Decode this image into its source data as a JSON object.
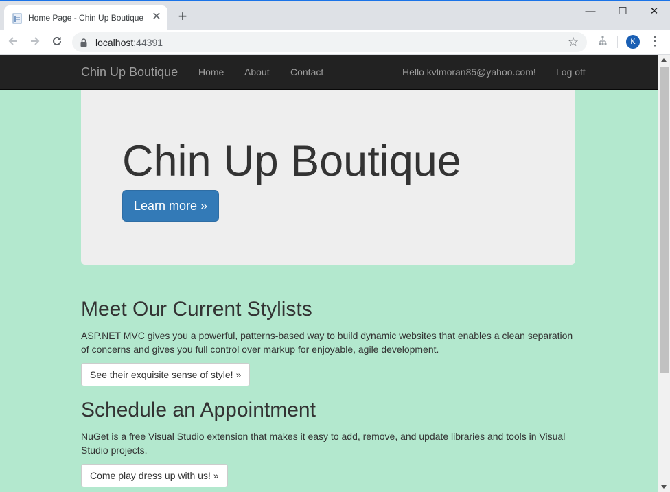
{
  "browser": {
    "tab_title": "Home Page - Chin Up Boutique",
    "new_tab_label": "+",
    "close_tab_label": "✕",
    "url_host": "localhost",
    "url_port": ":44391",
    "profile_initial": "K",
    "window_controls": {
      "minimize": "—",
      "maximize": "☐",
      "close": "✕"
    }
  },
  "navbar": {
    "brand": "Chin Up Boutique",
    "links": [
      "Home",
      "About",
      "Contact"
    ],
    "greeting": "Hello kvlmoran85@yahoo.com!",
    "logoff": "Log off"
  },
  "jumbotron": {
    "title": "Chin Up Boutique",
    "button": "Learn more »"
  },
  "sections": [
    {
      "title": "Meet Our Current Stylists",
      "text": "ASP.NET MVC gives you a powerful, patterns-based way to build dynamic websites that enables a clean separation of concerns and gives you full control over markup for enjoyable, agile development.",
      "button": "See their exquisite sense of style! »"
    },
    {
      "title": "Schedule an Appointment",
      "text": "NuGet is a free Visual Studio extension that makes it easy to add, remove, and update libraries and tools in Visual Studio projects.",
      "button": "Come play dress up with us! »"
    }
  ],
  "colors": {
    "page_background": "#b3e8ce",
    "navbar": "#222222",
    "jumbotron": "#eeeeee",
    "primary": "#337ab7"
  },
  "icons": [
    "page-favicon-icon",
    "back-arrow-icon",
    "forward-arrow-icon",
    "reload-icon",
    "lock-icon",
    "star-icon",
    "extension-icon",
    "more-menu-icon"
  ]
}
